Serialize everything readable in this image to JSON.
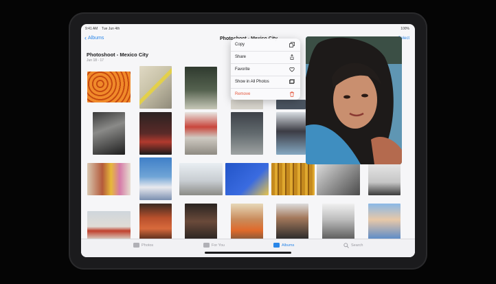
{
  "status_bar": {
    "time": "9:41 AM",
    "date": "Tue Jun 4th",
    "battery": "100%"
  },
  "nav": {
    "back_label": "Albums",
    "title": "Photoshoot - Mexico City",
    "right_label": "Select"
  },
  "album": {
    "title": "Photoshoot - Mexico City",
    "dates": "Jun 18 - 17"
  },
  "context_menu": {
    "items": [
      {
        "label": "Copy",
        "icon": "copy-icon"
      },
      {
        "label": "Share",
        "icon": "share-icon"
      },
      {
        "label": "Favorite",
        "icon": "heart-icon"
      },
      {
        "label": "Show in All Photos",
        "icon": "photos-icon"
      },
      {
        "label": "Remove",
        "icon": "trash-icon",
        "destructive": true
      }
    ]
  },
  "tabs": [
    {
      "label": "Photos",
      "icon": "photos-tab-icon",
      "active": false
    },
    {
      "label": "For You",
      "icon": "for-you-tab-icon",
      "active": false
    },
    {
      "label": "Albums",
      "icon": "albums-tab-icon",
      "active": true
    },
    {
      "label": "Search",
      "icon": "search-icon",
      "active": false
    }
  ],
  "colors": {
    "accent": "#2a86e8",
    "destructive": "#e4553a",
    "background": "#f6f6f8"
  }
}
